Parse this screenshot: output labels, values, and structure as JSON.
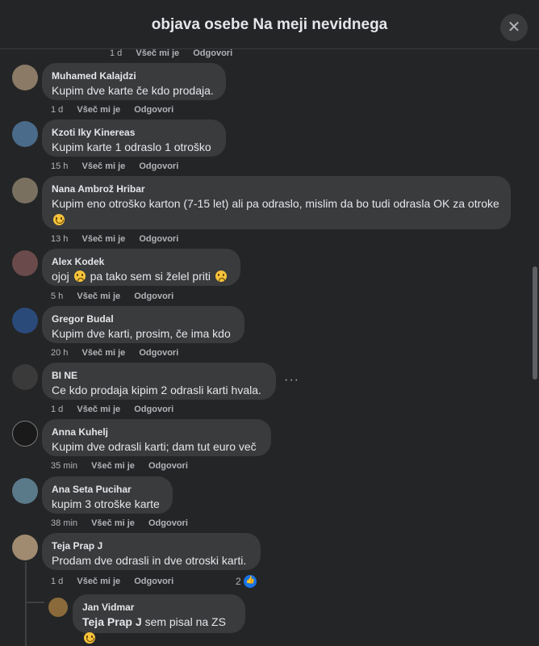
{
  "header": {
    "title": "objava osebe Na meji nevidnega",
    "close_icon": "close-icon"
  },
  "partial_top": {
    "time": "1 d",
    "like": "Všeč mi je",
    "reply": "Odgovori"
  },
  "comments": [
    {
      "name": "Muhamed Kalajdzi",
      "text": "Kupim dve karte če kdo prodaja.",
      "time": "1 d",
      "like": "Všeč mi je",
      "reply": "Odgovori",
      "avatar_color": "#8a7a66"
    },
    {
      "name": "Kzoti Iky Kinereas",
      "text": "Kupim karte 1 odraslo 1 otroško",
      "time": "15 h",
      "like": "Všeč mi je",
      "reply": "Odgovori",
      "avatar_color": "#4a6b8a"
    },
    {
      "name": "Nana Ambrož Hribar",
      "text": "Kupim eno otroško karton (7-15 let) ali pa odraslo, mislim da bo tudi odrasla OK za otroke",
      "time": "13 h",
      "like": "Všeč mi je",
      "reply": "Odgovori",
      "avatar_color": "#7a7060"
    },
    {
      "name": "Alex Kodek",
      "text_a": "ojoj",
      "text_b": "pa tako sem si želel priti",
      "time": "5 h",
      "like": "Všeč mi je",
      "reply": "Odgovori",
      "avatar_color": "#6a4a4a"
    },
    {
      "name": "Gregor Budal",
      "text": "Kupim dve karti, prosim, če ima kdo",
      "time": "20 h",
      "like": "Všeč mi je",
      "reply": "Odgovori",
      "avatar_color": "#2a4a7a"
    },
    {
      "name": "BI NE",
      "text": "Ce kdo prodaja kipim 2 odrasli karti hvala.",
      "time": "1 d",
      "like": "Všeč mi je",
      "reply": "Odgovori",
      "avatar_color": "#3a3a3a"
    },
    {
      "name": "Anna Kuhelj",
      "text": "Kupim dve odrasli karti; dam tut euro več",
      "time": "35 min",
      "like": "Všeč mi je",
      "reply": "Odgovori",
      "avatar_color": "#1a1a1a"
    },
    {
      "name": "Ana Seta Pucihar",
      "text": "kupim 3 otroške karte",
      "time": "38 min",
      "like": "Všeč mi je",
      "reply": "Odgovori",
      "avatar_color": "#5a7a8a"
    },
    {
      "name": "Teja Prap J",
      "text": "Prodam dve odrasli in dve otroski karti.",
      "time": "1 d",
      "like": "Všeč mi je",
      "reply": "Odgovori",
      "reaction_count": "2",
      "avatar_color": "#a08a70"
    }
  ],
  "reply": {
    "name": "Jan Vidmar",
    "mention": "Teja Prap J",
    "text": "sem pisal na ZS",
    "avatar_color": "#8a6a3a"
  },
  "colors": {
    "background": "#242526",
    "bubble": "#3a3b3c",
    "accent": "#1b74e4"
  }
}
